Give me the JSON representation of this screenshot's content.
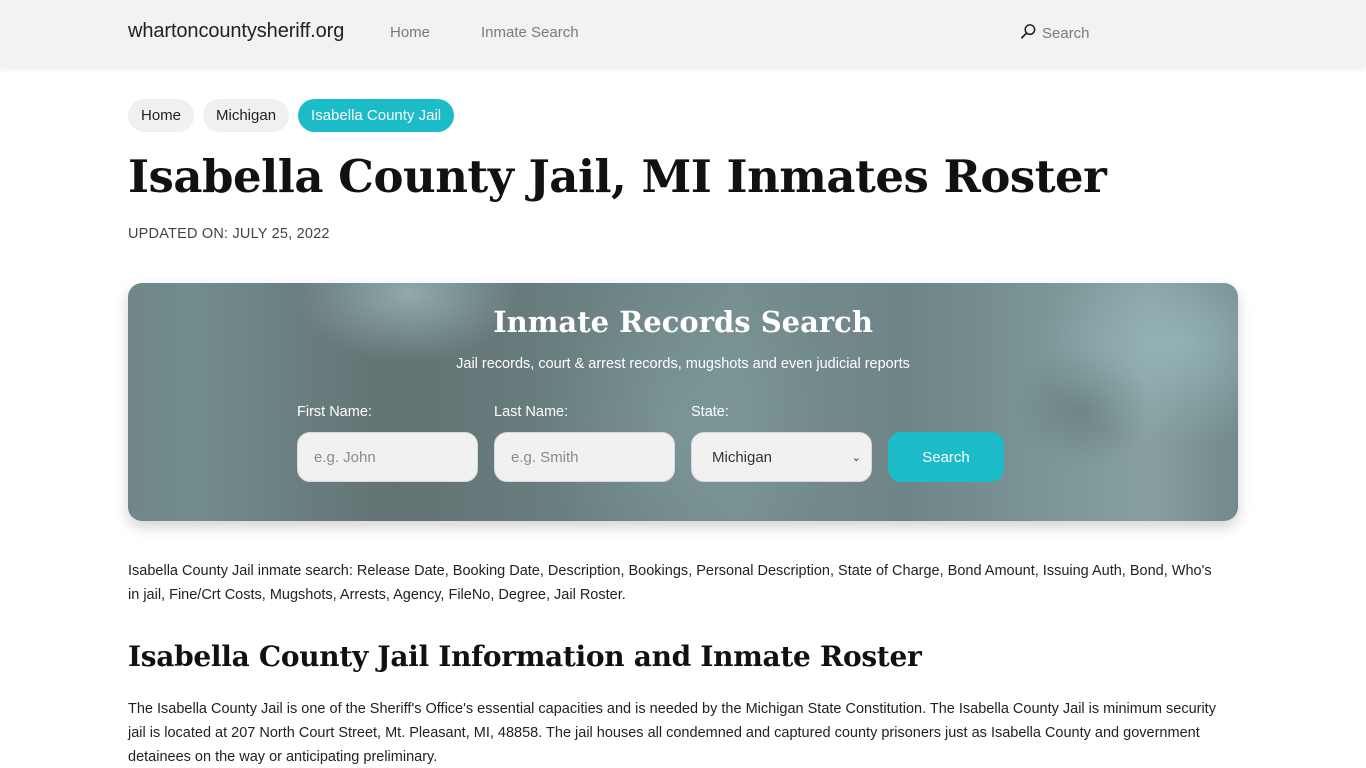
{
  "header": {
    "brand": "whartoncountysheriff.org",
    "nav": [
      {
        "label": "Home"
      },
      {
        "label": "Inmate Search"
      }
    ],
    "search_label": "Search",
    "search_icon": "search-icon"
  },
  "breadcrumb": [
    {
      "label": "Home",
      "active": false
    },
    {
      "label": "Michigan",
      "active": false
    },
    {
      "label": "Isabella County Jail",
      "active": true
    }
  ],
  "page": {
    "title": "Isabella County Jail, MI Inmates Roster",
    "updated": "UPDATED ON: JULY 25, 2022"
  },
  "search_panel": {
    "title": "Inmate Records Search",
    "subtitle": "Jail records, court & arrest records, mugshots and even judicial reports",
    "first_name": {
      "label": "First Name:",
      "placeholder": "e.g. John",
      "value": ""
    },
    "last_name": {
      "label": "Last Name:",
      "placeholder": "e.g. Smith",
      "value": ""
    },
    "state": {
      "label": "State:",
      "selected": "Michigan"
    },
    "button_label": "Search"
  },
  "content": {
    "keywords_paragraph": "Isabella County Jail inmate search: Release Date, Booking Date, Description, Bookings, Personal Description, State of Charge, Bond Amount, Issuing Auth, Bond, Who's in jail, Fine/Crt Costs, Mugshots, Arrests, Agency, FileNo, Degree, Jail Roster.",
    "section_title": "Isabella County Jail Information and Inmate Roster",
    "info_paragraph": "The Isabella County Jail is one of the Sheriff's Office's essential capacities and is needed by the Michigan State Constitution. The Isabella County Jail is minimum security jail is located at 207 North Court Street, Mt. Pleasant, MI, 48858. The jail houses all condemned and captured county prisoners just as Isabella County and government detainees on the way or anticipating preliminary."
  },
  "colors": {
    "accent": "#1bbcc8",
    "header_bg": "#f2f2f2",
    "panel_base": "#6f8788"
  }
}
